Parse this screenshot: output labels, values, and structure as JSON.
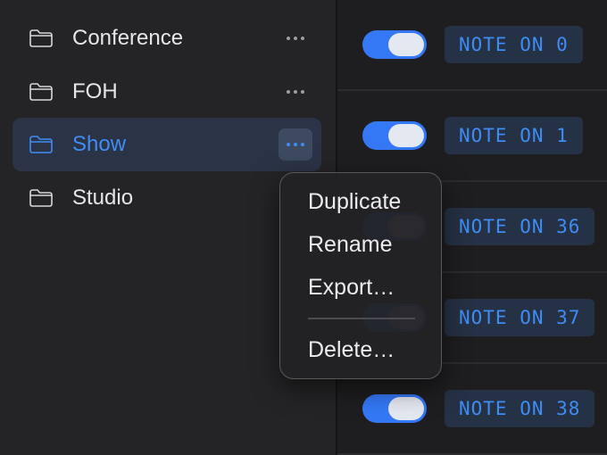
{
  "sidebar": {
    "items": [
      {
        "label": "Conference",
        "selected": false
      },
      {
        "label": "FOH",
        "selected": false
      },
      {
        "label": "Show",
        "selected": true
      },
      {
        "label": "Studio",
        "selected": false
      }
    ]
  },
  "rows": [
    {
      "label": "NOTE ON 0",
      "enabled": true
    },
    {
      "label": "NOTE ON 1",
      "enabled": true
    },
    {
      "label": "NOTE ON 36",
      "enabled": true
    },
    {
      "label": "NOTE ON 37",
      "enabled": true
    },
    {
      "label": "NOTE ON 38",
      "enabled": true
    }
  ],
  "context_menu": {
    "items": [
      "Duplicate",
      "Rename",
      "Export…",
      "Delete…"
    ]
  },
  "colors": {
    "accent": "#3f8cf5",
    "toggle_on": "#3478f6",
    "selection": "#2b3446"
  },
  "icons": {
    "folder": "folder-icon",
    "more": "ellipsis-icon"
  }
}
